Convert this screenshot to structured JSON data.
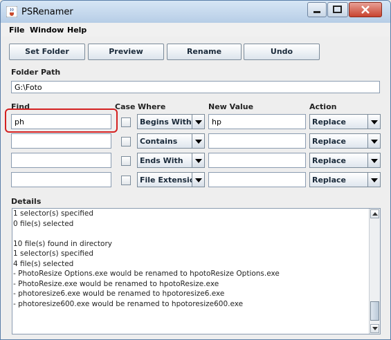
{
  "window": {
    "title": "PSRenamer",
    "icon": "java-cup-icon"
  },
  "menubar": {
    "items": [
      "File",
      "Window",
      "Help"
    ]
  },
  "toolbar": {
    "set_folder": "Set Folder",
    "preview": "Preview",
    "rename": "Rename",
    "undo": "Undo"
  },
  "folder": {
    "label": "Folder Path",
    "value": "G:\\Foto"
  },
  "rules": {
    "headers": {
      "find": "Find",
      "case": "Case",
      "where": "Where",
      "new_value": "New Value",
      "action": "Action"
    },
    "rows": [
      {
        "find": "ph",
        "case": false,
        "where": "Begins With",
        "new_value": "hp",
        "action": "Replace"
      },
      {
        "find": "",
        "case": false,
        "where": "Contains",
        "new_value": "",
        "action": "Replace"
      },
      {
        "find": "",
        "case": false,
        "where": "Ends With",
        "new_value": "",
        "action": "Replace"
      },
      {
        "find": "",
        "case": false,
        "where": "File Extension",
        "new_value": "",
        "action": "Replace"
      }
    ]
  },
  "details": {
    "label": "Details",
    "text": "1 selector(s) specified\n0 file(s) selected\n\n10 file(s) found in directory\n1 selector(s) specified\n4 file(s) selected\n- PhotoResize Options.exe would be renamed to hpotoResize Options.exe\n- PhotoResize.exe would be renamed to hpotoResize.exe\n- photoresize6.exe would be renamed to hpotoresize6.exe\n- photoresize600.exe would be renamed to hpotoresize600.exe"
  },
  "colors": {
    "highlight": "#d42020"
  }
}
